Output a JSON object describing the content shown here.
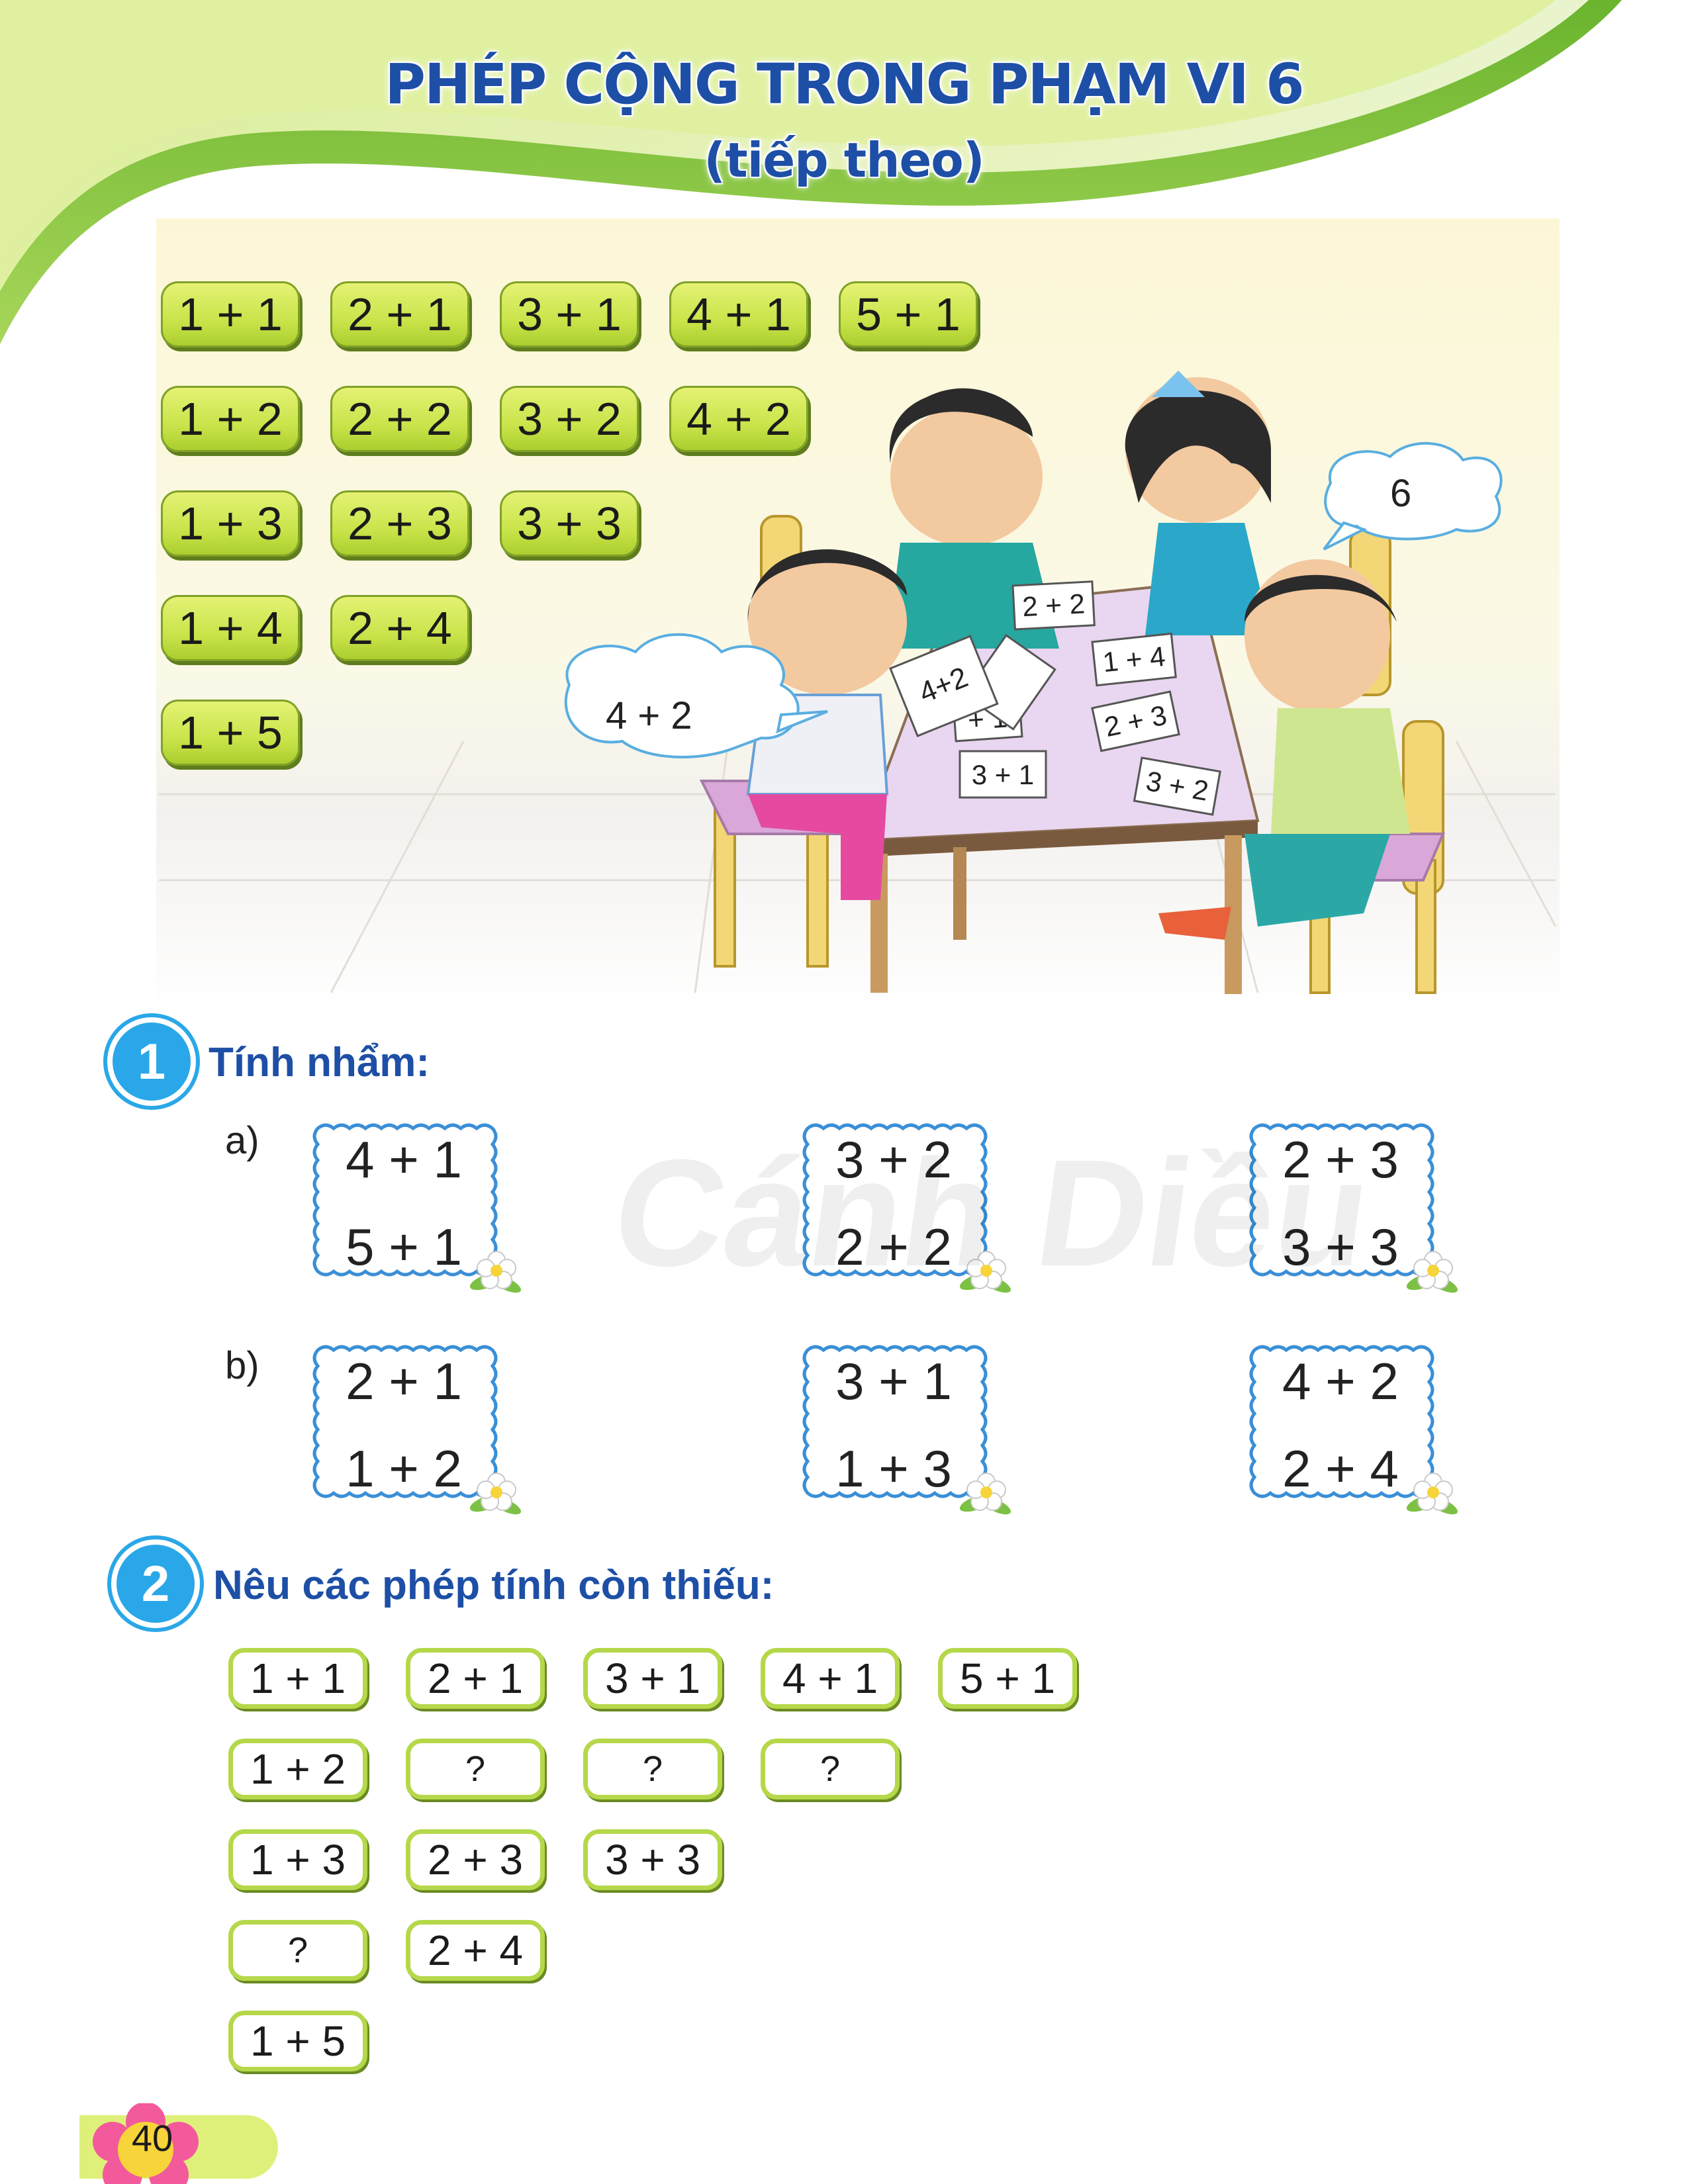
{
  "header": {
    "title": "PHÉP CỘNG TRONG PHẠM VI 6",
    "subtitle": "(tiếp theo)"
  },
  "addition_table": [
    [
      "1 + 1",
      "2 + 1",
      "3 + 1",
      "4 + 1",
      "5 + 1"
    ],
    [
      "1 + 2",
      "2 + 2",
      "3 + 2",
      "4 + 2"
    ],
    [
      "1 + 3",
      "2 + 3",
      "3 + 3"
    ],
    [
      "1 + 4",
      "2 + 4"
    ],
    [
      "1 + 5"
    ]
  ],
  "illustration": {
    "bubble_left": "4 + 2",
    "bubble_right": "6",
    "held_card": "4+2",
    "table_cards": [
      "2 + 2",
      "1 + 4",
      "+ 1",
      "2 + 3",
      "3 + 1",
      "3 + 2"
    ]
  },
  "exercise1": {
    "number": "1",
    "title": "Tính nhẩm:",
    "part_a": {
      "label": "a)",
      "boxes": [
        [
          "4 + 1",
          "5 + 1"
        ],
        [
          "3 + 2",
          "2 + 2"
        ],
        [
          "2 + 3",
          "3 + 3"
        ]
      ]
    },
    "part_b": {
      "label": "b)",
      "boxes": [
        [
          "2 + 1",
          "1 + 2"
        ],
        [
          "3 + 1",
          "1 + 3"
        ],
        [
          "4 + 2",
          "2 + 4"
        ]
      ]
    }
  },
  "exercise2": {
    "number": "2",
    "title": "Nêu các phép tính còn thiếu:",
    "rows": [
      [
        "1 + 1",
        "2 + 1",
        "3 + 1",
        "4 + 1",
        "5 + 1"
      ],
      [
        "1 + 2",
        "?",
        "?",
        "?"
      ],
      [
        "1 + 3",
        "2 + 3",
        "3 + 3"
      ],
      [
        "?",
        "2 + 4"
      ],
      [
        "1 + 5"
      ]
    ]
  },
  "watermark": "Cánh Diều",
  "page_number": "40",
  "colors": {
    "title_blue": "#1e4fa6",
    "header_green": "#8cc63f",
    "chip_green": "#c9e44a",
    "badge_blue": "#2aa7e8"
  }
}
